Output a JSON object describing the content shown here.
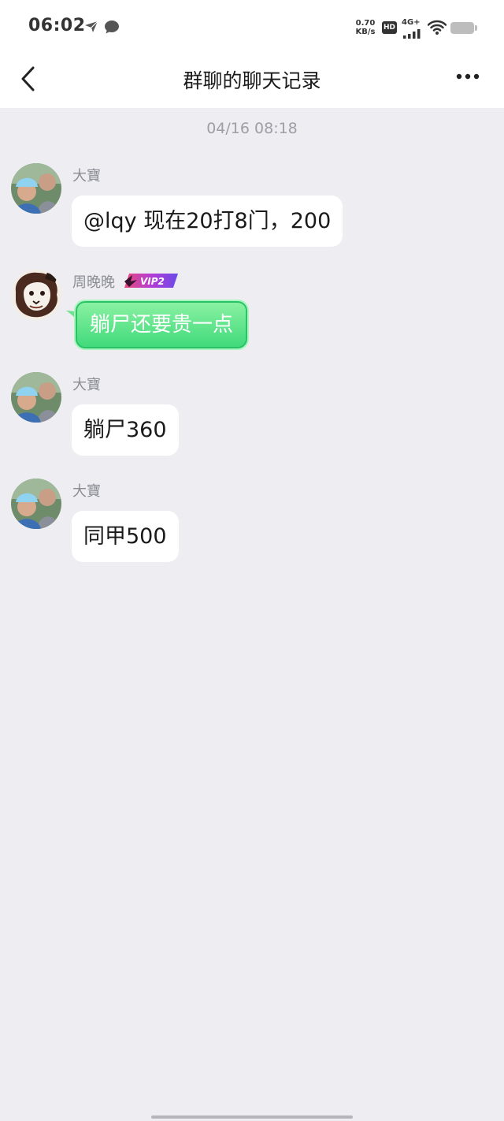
{
  "status_bar": {
    "time": "06:02",
    "net_speed_value": "0.70",
    "net_speed_unit": "KB/s",
    "hd_label": "HD",
    "network_type": "4G+",
    "icons": [
      "kite-icon",
      "chat-bubble-icon",
      "signal-icon",
      "wifi-icon",
      "battery-icon"
    ]
  },
  "nav": {
    "title": "群聊的聊天记录",
    "back_icon": "chevron-left-icon",
    "more_icon": "more-dots-icon"
  },
  "chat": {
    "timestamp": "04/16 08:18",
    "messages": [
      {
        "sender": "大寶",
        "text": "@lqy 现在20打8门，200",
        "style": "white",
        "avatar": "photo-avatar"
      },
      {
        "sender": "周晚晚",
        "badge": "VIP2",
        "text": "躺尸还要贵一点",
        "style": "green",
        "avatar": "lion-avatar"
      },
      {
        "sender": "大寶",
        "text": "躺尸360",
        "style": "white",
        "avatar": "photo-avatar"
      },
      {
        "sender": "大寶",
        "text": "同甲500",
        "style": "white",
        "avatar": "photo-avatar"
      }
    ]
  },
  "colors": {
    "background": "#EDEDF2",
    "bubble_white": "#FFFFFF",
    "bubble_green": "#3ED97A",
    "text_primary": "#1A1A1A",
    "text_secondary": "#8C8C94"
  }
}
